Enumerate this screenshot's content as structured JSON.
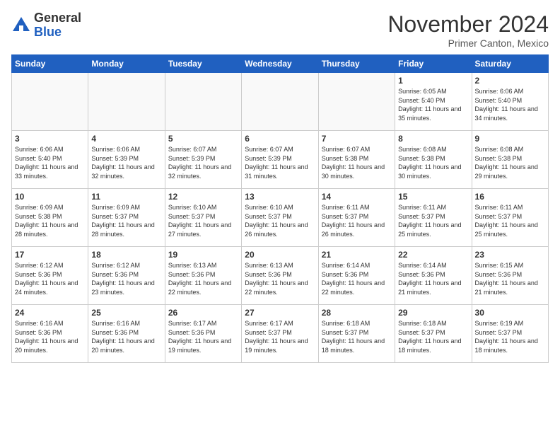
{
  "header": {
    "logo_general": "General",
    "logo_blue": "Blue",
    "month_title": "November 2024",
    "location": "Primer Canton, Mexico"
  },
  "weekdays": [
    "Sunday",
    "Monday",
    "Tuesday",
    "Wednesday",
    "Thursday",
    "Friday",
    "Saturday"
  ],
  "weeks": [
    [
      {
        "day": "",
        "empty": true
      },
      {
        "day": "",
        "empty": true
      },
      {
        "day": "",
        "empty": true
      },
      {
        "day": "",
        "empty": true
      },
      {
        "day": "",
        "empty": true
      },
      {
        "day": "1",
        "sunrise": "6:05 AM",
        "sunset": "5:40 PM",
        "daylight": "11 hours and 35 minutes."
      },
      {
        "day": "2",
        "sunrise": "6:06 AM",
        "sunset": "5:40 PM",
        "daylight": "11 hours and 34 minutes."
      }
    ],
    [
      {
        "day": "3",
        "sunrise": "6:06 AM",
        "sunset": "5:40 PM",
        "daylight": "11 hours and 33 minutes."
      },
      {
        "day": "4",
        "sunrise": "6:06 AM",
        "sunset": "5:39 PM",
        "daylight": "11 hours and 32 minutes."
      },
      {
        "day": "5",
        "sunrise": "6:07 AM",
        "sunset": "5:39 PM",
        "daylight": "11 hours and 32 minutes."
      },
      {
        "day": "6",
        "sunrise": "6:07 AM",
        "sunset": "5:39 PM",
        "daylight": "11 hours and 31 minutes."
      },
      {
        "day": "7",
        "sunrise": "6:07 AM",
        "sunset": "5:38 PM",
        "daylight": "11 hours and 30 minutes."
      },
      {
        "day": "8",
        "sunrise": "6:08 AM",
        "sunset": "5:38 PM",
        "daylight": "11 hours and 30 minutes."
      },
      {
        "day": "9",
        "sunrise": "6:08 AM",
        "sunset": "5:38 PM",
        "daylight": "11 hours and 29 minutes."
      }
    ],
    [
      {
        "day": "10",
        "sunrise": "6:09 AM",
        "sunset": "5:38 PM",
        "daylight": "11 hours and 28 minutes."
      },
      {
        "day": "11",
        "sunrise": "6:09 AM",
        "sunset": "5:37 PM",
        "daylight": "11 hours and 28 minutes."
      },
      {
        "day": "12",
        "sunrise": "6:10 AM",
        "sunset": "5:37 PM",
        "daylight": "11 hours and 27 minutes."
      },
      {
        "day": "13",
        "sunrise": "6:10 AM",
        "sunset": "5:37 PM",
        "daylight": "11 hours and 26 minutes."
      },
      {
        "day": "14",
        "sunrise": "6:11 AM",
        "sunset": "5:37 PM",
        "daylight": "11 hours and 26 minutes."
      },
      {
        "day": "15",
        "sunrise": "6:11 AM",
        "sunset": "5:37 PM",
        "daylight": "11 hours and 25 minutes."
      },
      {
        "day": "16",
        "sunrise": "6:11 AM",
        "sunset": "5:37 PM",
        "daylight": "11 hours and 25 minutes."
      }
    ],
    [
      {
        "day": "17",
        "sunrise": "6:12 AM",
        "sunset": "5:36 PM",
        "daylight": "11 hours and 24 minutes."
      },
      {
        "day": "18",
        "sunrise": "6:12 AM",
        "sunset": "5:36 PM",
        "daylight": "11 hours and 23 minutes."
      },
      {
        "day": "19",
        "sunrise": "6:13 AM",
        "sunset": "5:36 PM",
        "daylight": "11 hours and 22 minutes."
      },
      {
        "day": "20",
        "sunrise": "6:13 AM",
        "sunset": "5:36 PM",
        "daylight": "11 hours and 22 minutes."
      },
      {
        "day": "21",
        "sunrise": "6:14 AM",
        "sunset": "5:36 PM",
        "daylight": "11 hours and 22 minutes."
      },
      {
        "day": "22",
        "sunrise": "6:14 AM",
        "sunset": "5:36 PM",
        "daylight": "11 hours and 21 minutes."
      },
      {
        "day": "23",
        "sunrise": "6:15 AM",
        "sunset": "5:36 PM",
        "daylight": "11 hours and 21 minutes."
      }
    ],
    [
      {
        "day": "24",
        "sunrise": "6:16 AM",
        "sunset": "5:36 PM",
        "daylight": "11 hours and 20 minutes."
      },
      {
        "day": "25",
        "sunrise": "6:16 AM",
        "sunset": "5:36 PM",
        "daylight": "11 hours and 20 minutes."
      },
      {
        "day": "26",
        "sunrise": "6:17 AM",
        "sunset": "5:36 PM",
        "daylight": "11 hours and 19 minutes."
      },
      {
        "day": "27",
        "sunrise": "6:17 AM",
        "sunset": "5:37 PM",
        "daylight": "11 hours and 19 minutes."
      },
      {
        "day": "28",
        "sunrise": "6:18 AM",
        "sunset": "5:37 PM",
        "daylight": "11 hours and 18 minutes."
      },
      {
        "day": "29",
        "sunrise": "6:18 AM",
        "sunset": "5:37 PM",
        "daylight": "11 hours and 18 minutes."
      },
      {
        "day": "30",
        "sunrise": "6:19 AM",
        "sunset": "5:37 PM",
        "daylight": "11 hours and 18 minutes."
      }
    ]
  ]
}
